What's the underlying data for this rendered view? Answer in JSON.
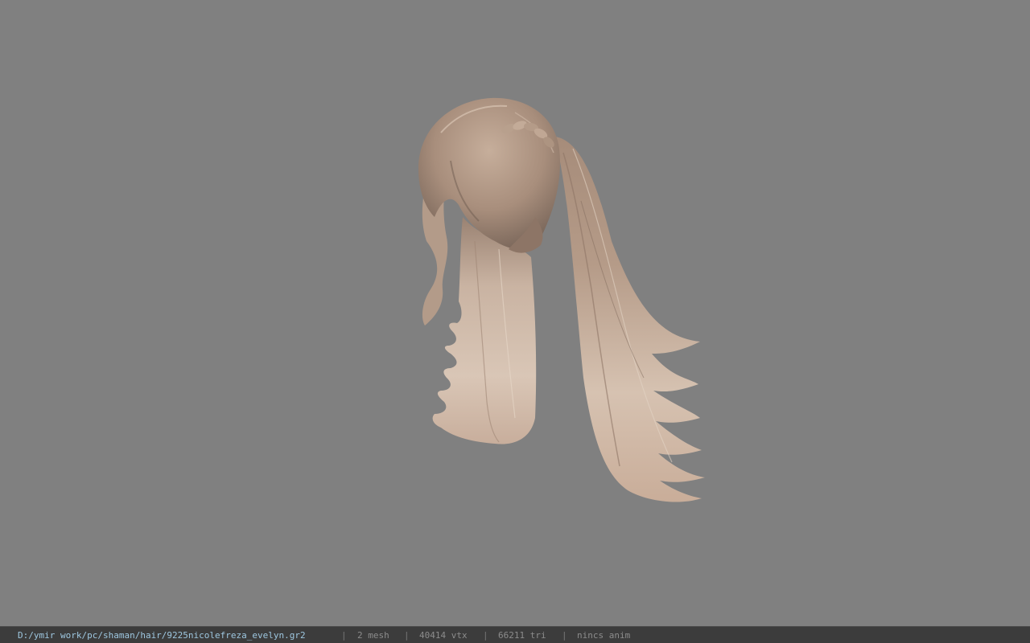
{
  "viewport": {
    "background": "#808080",
    "model_description_icon": "hair-model"
  },
  "statusbar": {
    "path": "D:/ymir work/pc/shaman/hair/9225nicolefreza_evelyn.gr2",
    "mesh": "2 mesh",
    "vtx": "40414 vtx",
    "tri": "66211 tri",
    "anim": "nincs anim",
    "separator": "|",
    "path_color": "#9ec7e0"
  }
}
